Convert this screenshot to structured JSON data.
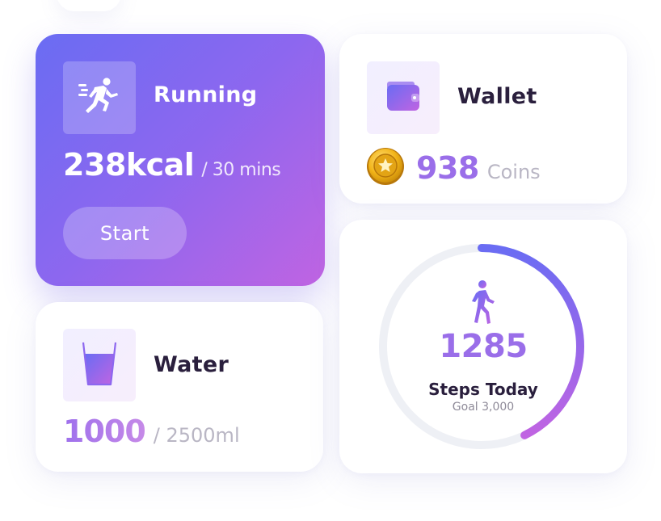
{
  "running": {
    "title": "Running",
    "calories": "238kcal",
    "duration": "/ 30 mins",
    "start_label": "Start",
    "icon": "running-person-icon"
  },
  "wallet": {
    "title": "Wallet",
    "amount": "938",
    "unit": "Coins",
    "icon": "wallet-icon",
    "coin_icon": "gold-coin-icon"
  },
  "water": {
    "title": "Water",
    "amount": "1000",
    "goal": "/ 2500ml",
    "icon": "water-glass-icon"
  },
  "steps": {
    "count": "1285",
    "label": "Steps Today",
    "goal_text": "Goal 3,000",
    "progress": 0.4283,
    "icon": "walking-person-icon"
  },
  "colors": {
    "accent_start": "#6a6cf3",
    "accent_end": "#c064e2",
    "accent_text": "#9a6ee9",
    "dark_text": "#2a1f3d",
    "muted_text": "#b9b6c4",
    "coin_gold": "#f2b418"
  }
}
